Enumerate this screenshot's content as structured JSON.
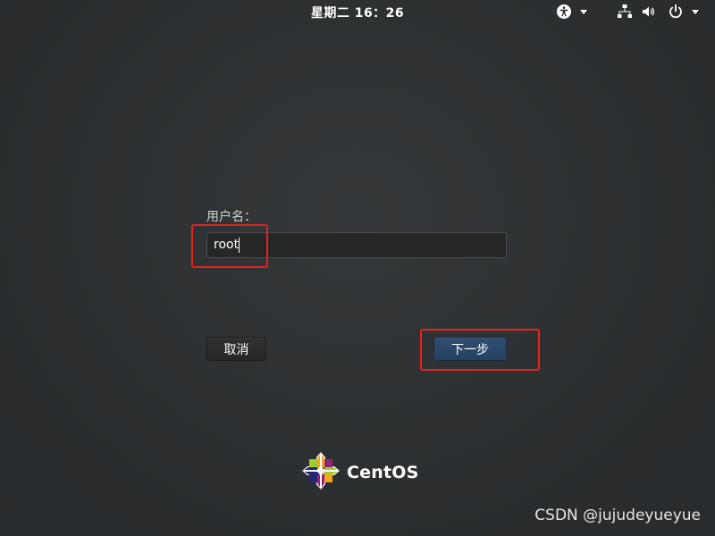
{
  "topbar": {
    "clock": "星期二 16：26",
    "icons": [
      "accessibility-icon",
      "network-wired-icon",
      "volume-icon",
      "power-icon"
    ]
  },
  "login": {
    "username_label": "用户名：",
    "username_value": "root",
    "cancel_label": "取消",
    "next_label": "下一步"
  },
  "brand": {
    "logo_text": "CentOS"
  },
  "watermark": "CSDN @jujudeyueyue",
  "colors": {
    "background": "#2e3133",
    "next_button": "#2b4a6e",
    "annotation": "#e8231d"
  }
}
